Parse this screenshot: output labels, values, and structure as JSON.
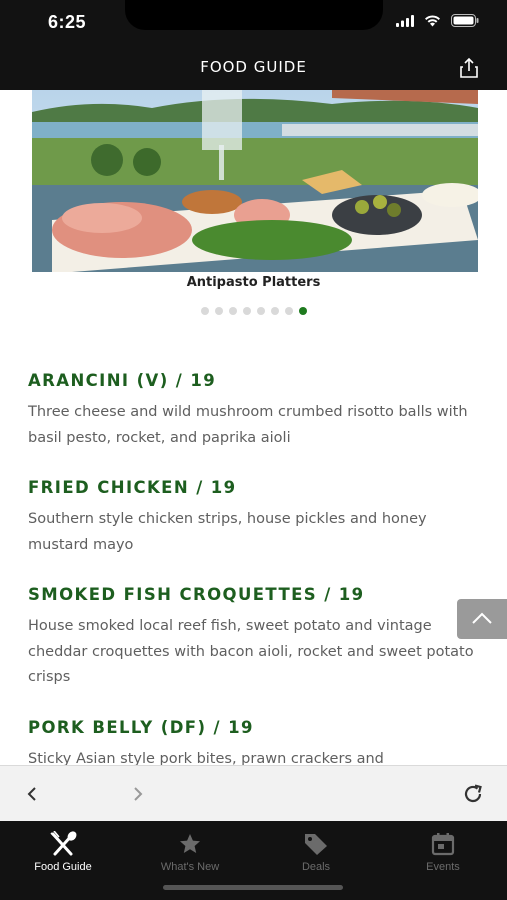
{
  "status_bar": {
    "time": "6:25"
  },
  "header": {
    "title": "FOOD GUIDE"
  },
  "carousel": {
    "caption": "Antipasto Platters",
    "total_slides": 8,
    "active_index": 7
  },
  "menu": {
    "items": [
      {
        "title": "ARANCINI (V) / 19",
        "description": "Three cheese and wild mushroom crumbed risotto balls with basil pesto, rocket, and paprika aioli"
      },
      {
        "title": "FRIED CHICKEN / 19",
        "description": "Southern style chicken strips, house pickles and honey mustard mayo"
      },
      {
        "title": "SMOKED FISH CROQUETTES / 19",
        "description": "House smoked local reef fish, sweet potato and vintage cheddar croquettes with bacon aioli, rocket and sweet potato crisps"
      },
      {
        "title": "PORK BELLY (DF) / 19",
        "description": "Sticky Asian style pork bites, prawn crackers and"
      }
    ]
  },
  "tabs": [
    {
      "label": "Food Guide",
      "icon": "fork-knife-icon",
      "active": true
    },
    {
      "label": "What's New",
      "icon": "star-icon",
      "active": false
    },
    {
      "label": "Deals",
      "icon": "tag-icon",
      "active": false
    },
    {
      "label": "Events",
      "icon": "calendar-icon",
      "active": false
    }
  ],
  "colors": {
    "accent": "#1d5e1f",
    "bar_bg": "#121212",
    "tab_active": "#ffffff",
    "tab_inactive": "#6b6b6b"
  }
}
